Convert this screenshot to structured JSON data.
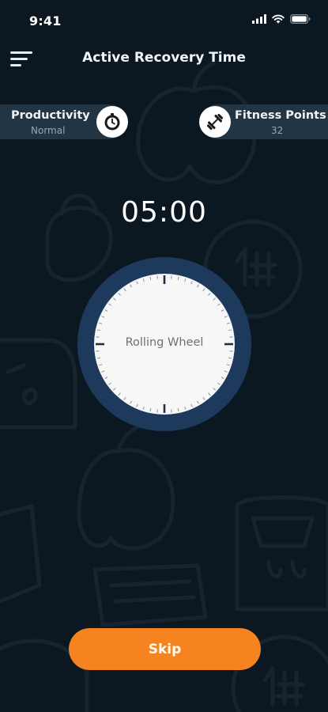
{
  "status_bar": {
    "time": "9:41"
  },
  "header": {
    "title": "Active Recovery Time",
    "menu_icon": "hamburger-menu-icon"
  },
  "stats": {
    "productivity": {
      "label": "Productivity",
      "value": "Normal",
      "icon": "stopwatch-icon"
    },
    "fitness_points": {
      "label": "Fitness Points",
      "value": "32",
      "icon": "dumbbell-icon"
    }
  },
  "timer": {
    "display": "05:00"
  },
  "dial": {
    "label": "Rolling Wheel"
  },
  "actions": {
    "skip_label": "Skip"
  },
  "colors": {
    "background": "#0c1821",
    "pill": "#223545",
    "dial_ring": "#1d3a5c",
    "dial_face": "#f7f7f7",
    "accent": "#f5831f"
  }
}
